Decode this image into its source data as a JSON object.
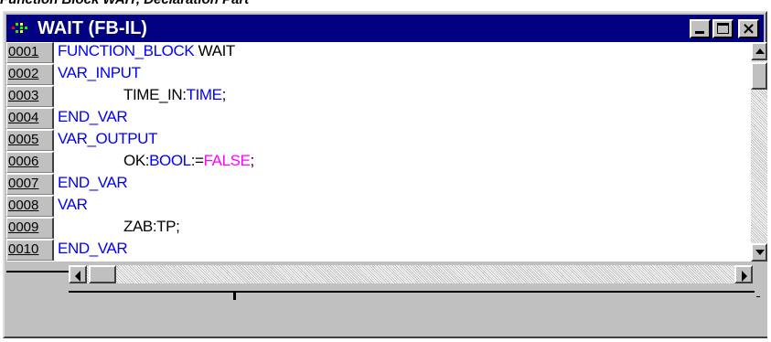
{
  "caption": "Function Block WAIT, Declaration Part",
  "window": {
    "title": "WAIT (FB-IL)",
    "buttons": {
      "minimize": "minimize",
      "maximize": "maximize",
      "close": "close"
    }
  },
  "colors": {
    "titlebar": "#000080",
    "keyword": "#0000ff",
    "text": "#000000",
    "literal": "#ff00ff",
    "chrome": "#c0c0c0"
  },
  "editor": {
    "lines": [
      {
        "num": "0001",
        "parts": [
          {
            "t": "FUNCTION_BLOCK ",
            "c": "kw"
          },
          {
            "t": "WAIT",
            "c": "bl"
          }
        ]
      },
      {
        "num": "0002",
        "parts": [
          {
            "t": "VAR_INPUT",
            "c": "kw"
          }
        ]
      },
      {
        "num": "0003",
        "indent": true,
        "parts": [
          {
            "t": "TIME_IN:",
            "c": "bl"
          },
          {
            "t": "TIME",
            "c": "kw"
          },
          {
            "t": ";",
            "c": "bl"
          }
        ]
      },
      {
        "num": "0004",
        "parts": [
          {
            "t": "END_VAR",
            "c": "kw"
          }
        ]
      },
      {
        "num": "0005",
        "parts": [
          {
            "t": "VAR_OUTPUT",
            "c": "kw"
          }
        ]
      },
      {
        "num": "0006",
        "indent": true,
        "parts": [
          {
            "t": "OK:",
            "c": "bl"
          },
          {
            "t": "BOOL",
            "c": "kw"
          },
          {
            "t": ":=",
            "c": "bl"
          },
          {
            "t": "FALSE",
            "c": "mg"
          },
          {
            "t": ";",
            "c": "bl"
          }
        ]
      },
      {
        "num": "0007",
        "parts": [
          {
            "t": "END_VAR",
            "c": "kw"
          }
        ]
      },
      {
        "num": "0008",
        "parts": [
          {
            "t": "VAR",
            "c": "kw"
          }
        ]
      },
      {
        "num": "0009",
        "indent": true,
        "parts": [
          {
            "t": "ZAB:TP;",
            "c": "bl"
          }
        ]
      },
      {
        "num": "0010",
        "parts": [
          {
            "t": "END_VAR",
            "c": "kw"
          }
        ]
      }
    ]
  },
  "icons": {
    "app": "instruction-list-icon",
    "scroll_up": "arrow-up-icon",
    "scroll_down": "arrow-down-icon",
    "scroll_left": "arrow-left-icon",
    "scroll_right": "arrow-right-icon"
  }
}
